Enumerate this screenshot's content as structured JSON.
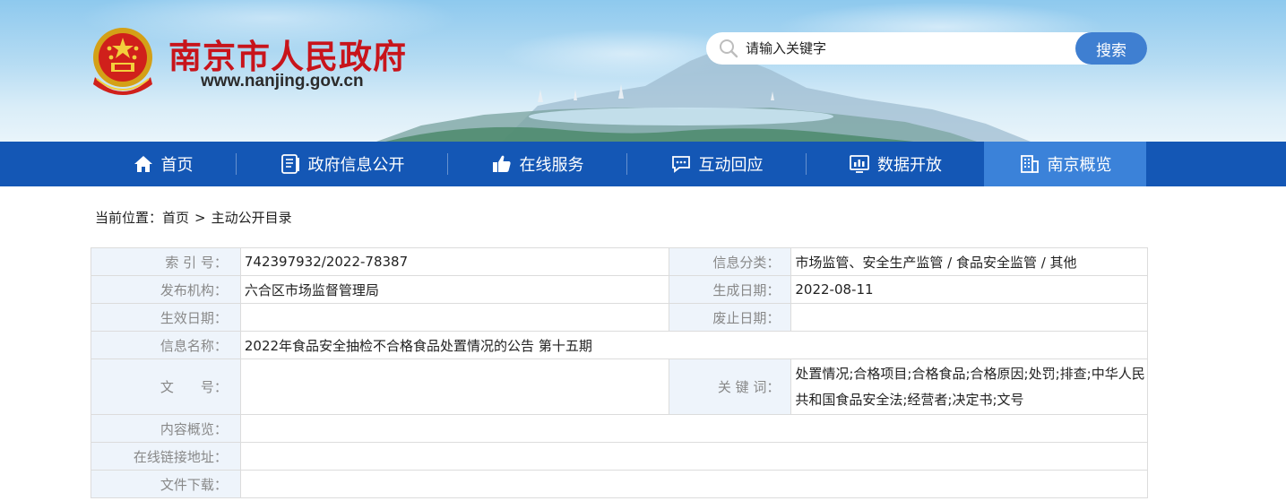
{
  "header": {
    "site_title": "南京市人民政府",
    "site_url": "www.nanjing.gov.cn",
    "emblem_icon": "national-emblem-icon"
  },
  "search": {
    "placeholder": "请输入关键字",
    "button_label": "搜索"
  },
  "nav": {
    "items": [
      {
        "label": "首页",
        "icon": "home-icon"
      },
      {
        "label": "政府信息公开",
        "icon": "document-icon"
      },
      {
        "label": "在线服务",
        "icon": "thumbs-up-icon"
      },
      {
        "label": "互动回应",
        "icon": "chat-icon"
      },
      {
        "label": "数据开放",
        "icon": "chart-screen-icon"
      },
      {
        "label": "南京概览",
        "icon": "building-icon"
      }
    ],
    "active_index": 5
  },
  "breadcrumb": {
    "prefix": "当前位置：",
    "home": "首页",
    "separator": ">",
    "current": "主动公开目录"
  },
  "info": {
    "index_no_label": "索 引 号：",
    "index_no": "742397932/2022-78387",
    "category_label": "信息分类：",
    "category": "市场监管、安全生产监管 / 食品安全监管 / 其他",
    "publisher_label": "发布机构：",
    "publisher": "六合区市场监督管理局",
    "created_label": "生成日期：",
    "created": "2022-08-11",
    "effective_label": "生效日期：",
    "effective": "",
    "abolished_label": "废止日期：",
    "abolished": "",
    "name_label": "信息名称：",
    "name": "2022年食品安全抽检不合格食品处置情况的公告 第十五期",
    "doc_no_label": "文　　号：",
    "doc_no": "",
    "keywords_label": "关 键 词：",
    "keywords": "处置情况;合格项目;合格食品;合格原因;处罚;排查;中华人民共和国食品安全法;经营者;决定书;文号",
    "summary_label": "内容概览：",
    "summary": "",
    "link_label": "在线链接地址：",
    "link": "",
    "download_label": "文件下载：",
    "download": ""
  },
  "colors": {
    "title_red": "#c8141b",
    "nav_blue": "#1457b5",
    "nav_active": "#3b82d9",
    "search_button": "#3f7fd1",
    "label_bg": "#eef4fb"
  }
}
